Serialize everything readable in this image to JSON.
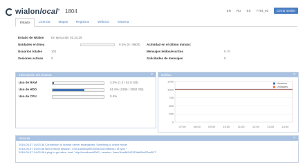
{
  "header": {
    "brand_main": "wialon",
    "brand_tm": "local",
    "brand_tm_mark": "®",
    "version": "1804",
    "top_links": [
      "EN",
      "RU",
      "ES",
      "7754_ed"
    ],
    "close_label": "Cerrar sesión"
  },
  "tabs": [
    {
      "label": "Estado",
      "active": true
    },
    {
      "label": "Licencia",
      "active": false
    },
    {
      "label": "Mapas",
      "active": false
    },
    {
      "label": "Registros",
      "active": false
    },
    {
      "label": "WebGIS",
      "active": false
    },
    {
      "label": "Sistema",
      "active": false
    }
  ],
  "status": {
    "state_label": "Estado de Wialon",
    "state_value": "En ejecución  01:34:29",
    "units_online_label": "Unidades en línea",
    "units_online_value": "",
    "units_online_bar_text": "0.0% (0 / 9800)",
    "users_total_label": "Usuarios totales",
    "users_total_value": "101",
    "sessions_label": "Sesiones activas",
    "sessions_value": "0",
    "activity_label": "Actividad en el último minuto:",
    "activity_value": "",
    "messages_label": "Mensajes leídos/escritos",
    "messages_value": "0 / 0",
    "requests_label": "Solicitudes de mensajes",
    "requests_value": "0"
  },
  "system_info": {
    "title": "Información del sistema",
    "rows": [
      {
        "label": "Uso de RAM",
        "percent": 3,
        "text": "3.0% (1.3 / 62.8 GB)"
      },
      {
        "label": "Uso de HDD",
        "percent": 61.6,
        "text": "61.6% (2286 / 3082 GB)"
      },
      {
        "label": "Uso de CPU",
        "percent": 0,
        "text": "0.4%"
      }
    ]
  },
  "chart_panel": {
    "title": "Gráfico"
  },
  "chart_data": {
    "type": "line",
    "x": [
      "07:00",
      "08:00",
      "09:00",
      "10:00",
      "11:00",
      "12:00",
      "13:00",
      "14:00"
    ],
    "yticks": [
      0,
      250,
      500,
      750,
      1000,
      1250
    ],
    "ylim": [
      0,
      1250
    ],
    "series": [
      {
        "name": "Usuarios",
        "color": "#3f72b7",
        "values": [
          1010,
          1010,
          1010,
          1010,
          1010,
          1010,
          1010,
          1010
        ]
      },
      {
        "name": "Unidades",
        "color": "#e8734a",
        "values": [
          1000,
          1000,
          1000,
          1000,
          1000,
          1000,
          1000,
          1000
        ]
      }
    ],
    "legend": "top-right"
  },
  "log": {
    "title": "Historial",
    "lines": [
      "2018-05-07 14:03:36 Connection to license server established. Switching to online mode",
      "2018-05-07 14:03:36 New remote session: 47bc1ad06d2600005531001ffbd5c1 of type ''",
      "2018-05-07 14:03:36 trying to get sites: host: 'http://localhost:8001', session: 'bacc1fee8b2d2123bbf5bd22ad517'"
    ]
  },
  "colors": {
    "accent": "#4a7ec2",
    "panel_header": "#a9c2e2",
    "bar_fill": "#3f72b7"
  }
}
